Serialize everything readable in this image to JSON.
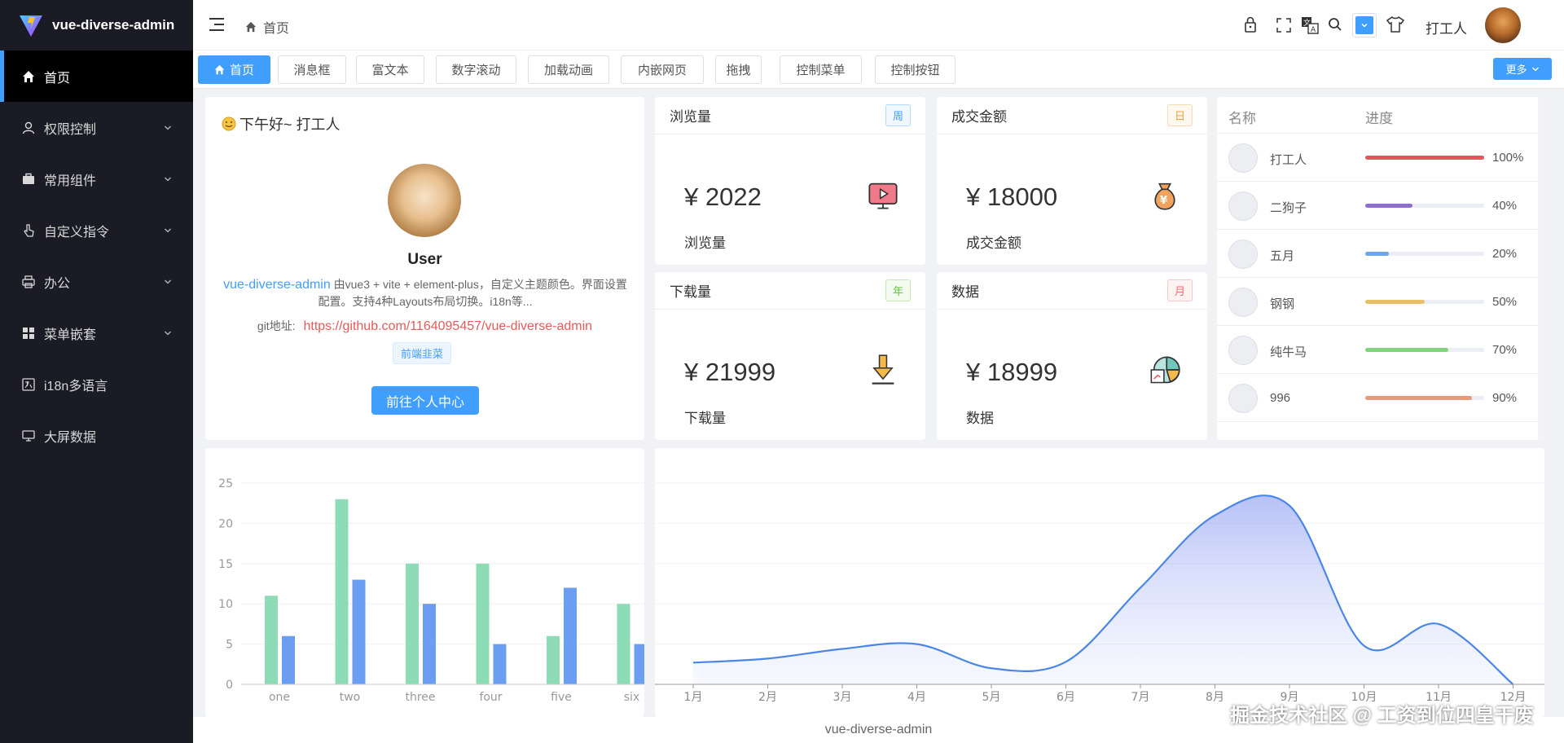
{
  "app": {
    "title": "vue-diverse-admin"
  },
  "sidebar": {
    "items": [
      {
        "label": "首页",
        "icon": "home-icon",
        "active": true,
        "expandable": false
      },
      {
        "label": "权限控制",
        "icon": "user-icon",
        "expandable": true
      },
      {
        "label": "常用组件",
        "icon": "briefcase-icon",
        "expandable": true
      },
      {
        "label": "自定义指令",
        "icon": "pointer-icon",
        "expandable": true
      },
      {
        "label": "办公",
        "icon": "printer-icon",
        "expandable": true
      },
      {
        "label": "菜单嵌套",
        "icon": "grid-icon",
        "expandable": true
      },
      {
        "label": "i18n多语言",
        "icon": "translate-icon",
        "expandable": false
      },
      {
        "label": "大屏数据",
        "icon": "monitor-icon",
        "expandable": false
      }
    ]
  },
  "header": {
    "breadcrumb": "首页",
    "username": "打工人"
  },
  "tabs": [
    {
      "label": "首页",
      "active": true
    },
    {
      "label": "消息框"
    },
    {
      "label": "富文本"
    },
    {
      "label": "数字滚动"
    },
    {
      "label": "加载动画"
    },
    {
      "label": "内嵌网页"
    },
    {
      "label": "拖拽"
    },
    {
      "label": "控制菜单"
    },
    {
      "label": "控制按钮"
    }
  ],
  "more_button": "更多",
  "profile": {
    "greeting": "下午好~ 打工人",
    "name": "User",
    "link_text": "vue-diverse-admin",
    "description": " 由vue3 + vite + element-plus，自定义主题颜色。界面设置配置。支持4种Layouts布局切换。i18n等...",
    "git_label": "git地址:",
    "git_url": "https://github.com/1164095457/vue-diverse-admin",
    "tag": "前端韭菜",
    "button": "前往个人中心"
  },
  "stats": [
    {
      "title": "浏览量",
      "badge": "周",
      "value": "¥ 2022",
      "label": "浏览量",
      "badge_color": "#409eff",
      "icon": "video-icon"
    },
    {
      "title": "成交金额",
      "badge": "日",
      "value": "¥ 18000",
      "label": "成交金额",
      "badge_color": "#e6a23c",
      "icon": "money-bag-icon"
    },
    {
      "title": "下载量",
      "badge": "年",
      "value": "¥ 21999",
      "label": "下载量",
      "badge_color": "#67c23a",
      "icon": "download-icon"
    },
    {
      "title": "数据",
      "badge": "月",
      "value": "¥ 18999",
      "label": "数据",
      "badge_color": "#f56c6c",
      "icon": "chart-icon"
    }
  ],
  "progress_table": {
    "headers": [
      "名称",
      "进度"
    ],
    "rows": [
      {
        "name": "打工人",
        "pct": "100%",
        "value": 1.0,
        "color": "#e0575b"
      },
      {
        "name": "二狗子",
        "pct": "40%",
        "value": 0.4,
        "color": "#8e6fd1"
      },
      {
        "name": "五月",
        "pct": "20%",
        "value": 0.2,
        "color": "#6aa6e8"
      },
      {
        "name": "钢钢",
        "pct": "50%",
        "value": 0.5,
        "color": "#e8c06a"
      },
      {
        "name": "纯牛马",
        "pct": "70%",
        "value": 0.7,
        "color": "#7ed67a"
      },
      {
        "name": "996",
        "pct": "90%",
        "value": 0.9,
        "color": "#e59a7a"
      }
    ]
  },
  "chart_data": [
    {
      "type": "bar",
      "categories": [
        "one",
        "two",
        "three",
        "four",
        "five",
        "six"
      ],
      "series": [
        {
          "values": [
            11,
            23,
            15,
            15,
            6,
            10
          ],
          "color": "#8edcb6"
        },
        {
          "values": [
            6,
            13,
            10,
            5,
            12,
            5
          ],
          "color": "#6b9ef0"
        }
      ],
      "yticks": [
        "0",
        "5",
        "10",
        "15",
        "20",
        "25"
      ],
      "ylim": [
        0,
        25
      ]
    },
    {
      "type": "area",
      "categories": [
        "1月",
        "2月",
        "3月",
        "4月",
        "5月",
        "6月",
        "7月",
        "8月",
        "9月",
        "10月",
        "11月",
        "12月"
      ],
      "values": [
        27,
        32,
        44,
        50,
        20,
        28,
        120,
        210,
        222,
        48,
        75,
        0
      ],
      "ylim": [
        0,
        250
      ],
      "color": "#4a86e8"
    }
  ],
  "footer": "vue-diverse-admin",
  "watermark": "掘金技术社区 @ 工资到位四皇干废"
}
